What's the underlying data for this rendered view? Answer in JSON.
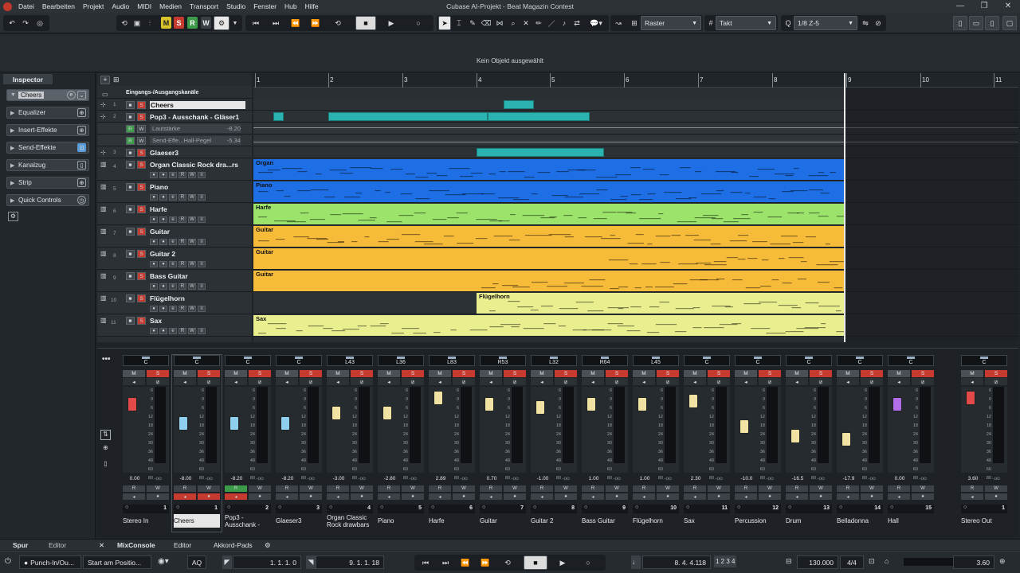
{
  "menubar": {
    "items": [
      "Datei",
      "Bearbeiten",
      "Projekt",
      "Audio",
      "MIDI",
      "Medien",
      "Transport",
      "Studio",
      "Fenster",
      "Hub",
      "Hilfe"
    ],
    "window_title": "Cubase AI-Projekt - Beat Magazin Contest"
  },
  "toolbar": {
    "m_label": "M",
    "s_label": "S",
    "r_label": "R",
    "w_label": "W",
    "snap_type": "Raster",
    "grid_type": "Takt",
    "quantize": "1/8 Z-5"
  },
  "status": {
    "text": "Kein Objekt ausgewählt"
  },
  "inspector": {
    "tab": "Inspector",
    "track_name": "Cheers",
    "sections": [
      "Equalizer",
      "Insert-Effekte",
      "Send-Effekte",
      "Kanalzug",
      "Strip",
      "Quick Controls"
    ]
  },
  "tracklist": {
    "folder": "Eingangs-/Ausgangskanäle",
    "tracks": [
      {
        "num": "1",
        "name": "Cheers"
      },
      {
        "num": "2",
        "name": "Pop3 - Ausschank - Gläser1"
      },
      {
        "num": "3",
        "name": "Glaeser3"
      },
      {
        "num": "4",
        "name": "Organ Classic Rock dra...rs"
      },
      {
        "num": "5",
        "name": "Piano"
      },
      {
        "num": "6",
        "name": "Harfe"
      },
      {
        "num": "7",
        "name": "Guitar"
      },
      {
        "num": "8",
        "name": "Guitar 2"
      },
      {
        "num": "9",
        "name": "Bass Guitar"
      },
      {
        "num": "10",
        "name": "Flügelhorn"
      },
      {
        "num": "11",
        "name": "Sax"
      }
    ],
    "lanes": [
      {
        "label": "Lautstärke",
        "value": "-8.20"
      },
      {
        "label": "Send-Effe...Hall-Pegel",
        "value": "-5.34"
      }
    ]
  },
  "ruler": {
    "bars": [
      "1",
      "2",
      "3",
      "4",
      "5",
      "6",
      "7",
      "8",
      "9",
      "10",
      "11"
    ]
  },
  "events": {
    "organ": "Organ",
    "piano": "Piano",
    "harfe": "Harfe",
    "guitar": "Guitar",
    "guitar2": "Guitar",
    "bass": "Guitar",
    "fluegelhorn": "Flügelhorn",
    "sax": "Sax"
  },
  "mixer": {
    "channels": [
      {
        "name": "Stereo In",
        "pan": "C",
        "vol": "0.00",
        "peak": "-oo",
        "num": "1"
      },
      {
        "name": "Cheers",
        "pan": "C",
        "vol": "-8.00",
        "peak": "-oo",
        "num": "1"
      },
      {
        "name": "Pop3 - Ausschank - Gläser1",
        "pan": "C",
        "vol": "-8.20",
        "peak": "-oo",
        "num": "2"
      },
      {
        "name": "Glaeser3",
        "pan": "C",
        "vol": "-8.20",
        "peak": "-oo",
        "num": "3"
      },
      {
        "name": "Organ Classic Rock drawbars",
        "pan": "L43",
        "vol": "-3.00",
        "peak": "-oo",
        "num": "4"
      },
      {
        "name": "Piano",
        "pan": "L36",
        "vol": "-2.80",
        "peak": "-oo",
        "num": "5"
      },
      {
        "name": "Harfe",
        "pan": "L83",
        "vol": "2.89",
        "peak": "-oo",
        "num": "6"
      },
      {
        "name": "Guitar",
        "pan": "R53",
        "vol": "0.70",
        "peak": "-oo",
        "num": "7"
      },
      {
        "name": "Guitar 2",
        "pan": "L32",
        "vol": "-1.00",
        "peak": "-oo",
        "num": "8"
      },
      {
        "name": "Bass Guitar",
        "pan": "R64",
        "vol": "1.00",
        "peak": "-oo",
        "num": "9"
      },
      {
        "name": "Flügelhorn",
        "pan": "L45",
        "vol": "1.00",
        "peak": "-oo",
        "num": "10"
      },
      {
        "name": "Sax",
        "pan": "C",
        "vol": "2.30",
        "peak": "-oo",
        "num": "11"
      },
      {
        "name": "Percussion",
        "pan": "C",
        "vol": "-10.0",
        "peak": "-oo",
        "num": "12"
      },
      {
        "name": "Drum",
        "pan": "C",
        "vol": "-16.5",
        "peak": "-oo",
        "num": "13"
      },
      {
        "name": "Belladonna",
        "pan": "C",
        "vol": "-17.9",
        "peak": "-oo",
        "num": "14"
      },
      {
        "name": "Hall",
        "pan": "C",
        "vol": "0.00",
        "peak": "-oo",
        "num": "15"
      },
      {
        "name": "Stereo Out",
        "pan": "C",
        "vol": "3.60",
        "peak": "-oo",
        "num": "1"
      }
    ],
    "scale": [
      "6",
      "0",
      "6",
      "12",
      "18",
      "24",
      "30",
      "36",
      "48",
      "60",
      "80"
    ]
  },
  "lower_tabs": [
    "Spur",
    "Editor",
    "MixConsole",
    "Editor",
    "Akkord-Pads"
  ],
  "transport": {
    "punch": "Punch-In/Ou...",
    "start": "Start am Positio...",
    "aq": "AQ",
    "left_locator": "1. 1. 1.   0",
    "right_locator": "9. 1. 1. 18",
    "position": "8. 4. 4.118",
    "tempo": "130.000",
    "signature": "4/4",
    "level": "3.60"
  }
}
